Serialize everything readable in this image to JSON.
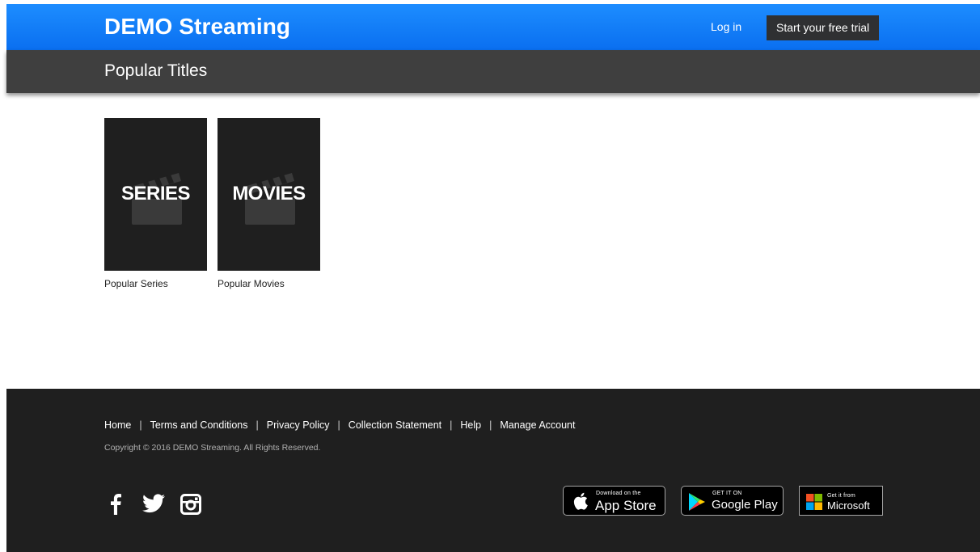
{
  "header": {
    "brand": "DEMO Streaming",
    "login_label": "Log in",
    "trial_label": "Start your free trial"
  },
  "subheader": {
    "title": "Popular Titles"
  },
  "tiles": [
    {
      "poster_label": "SERIES",
      "caption": "Popular Series"
    },
    {
      "poster_label": "MOVIES",
      "caption": "Popular Movies"
    }
  ],
  "footer": {
    "links": [
      "Home",
      "Terms and Conditions",
      "Privacy Policy",
      "Collection Statement",
      "Help",
      "Manage Account"
    ],
    "separator": "|",
    "copyright": "Copyright © 2016 DEMO Streaming. All Rights Reserved.",
    "social": [
      "facebook-icon",
      "twitter-icon",
      "instagram-icon"
    ],
    "stores": {
      "apple": {
        "small": "Download on the",
        "big": "App Store"
      },
      "google": {
        "small": "GET IT ON",
        "big": "Google Play"
      },
      "microsoft": {
        "small": "Get it from",
        "big": "Microsoft"
      }
    }
  },
  "colors": {
    "header_blue": "#0a6ff0",
    "subheader_gray": "#3f3f3f",
    "poster_bg": "#1f1f1f",
    "footer_bg": "#1f1f1f"
  }
}
